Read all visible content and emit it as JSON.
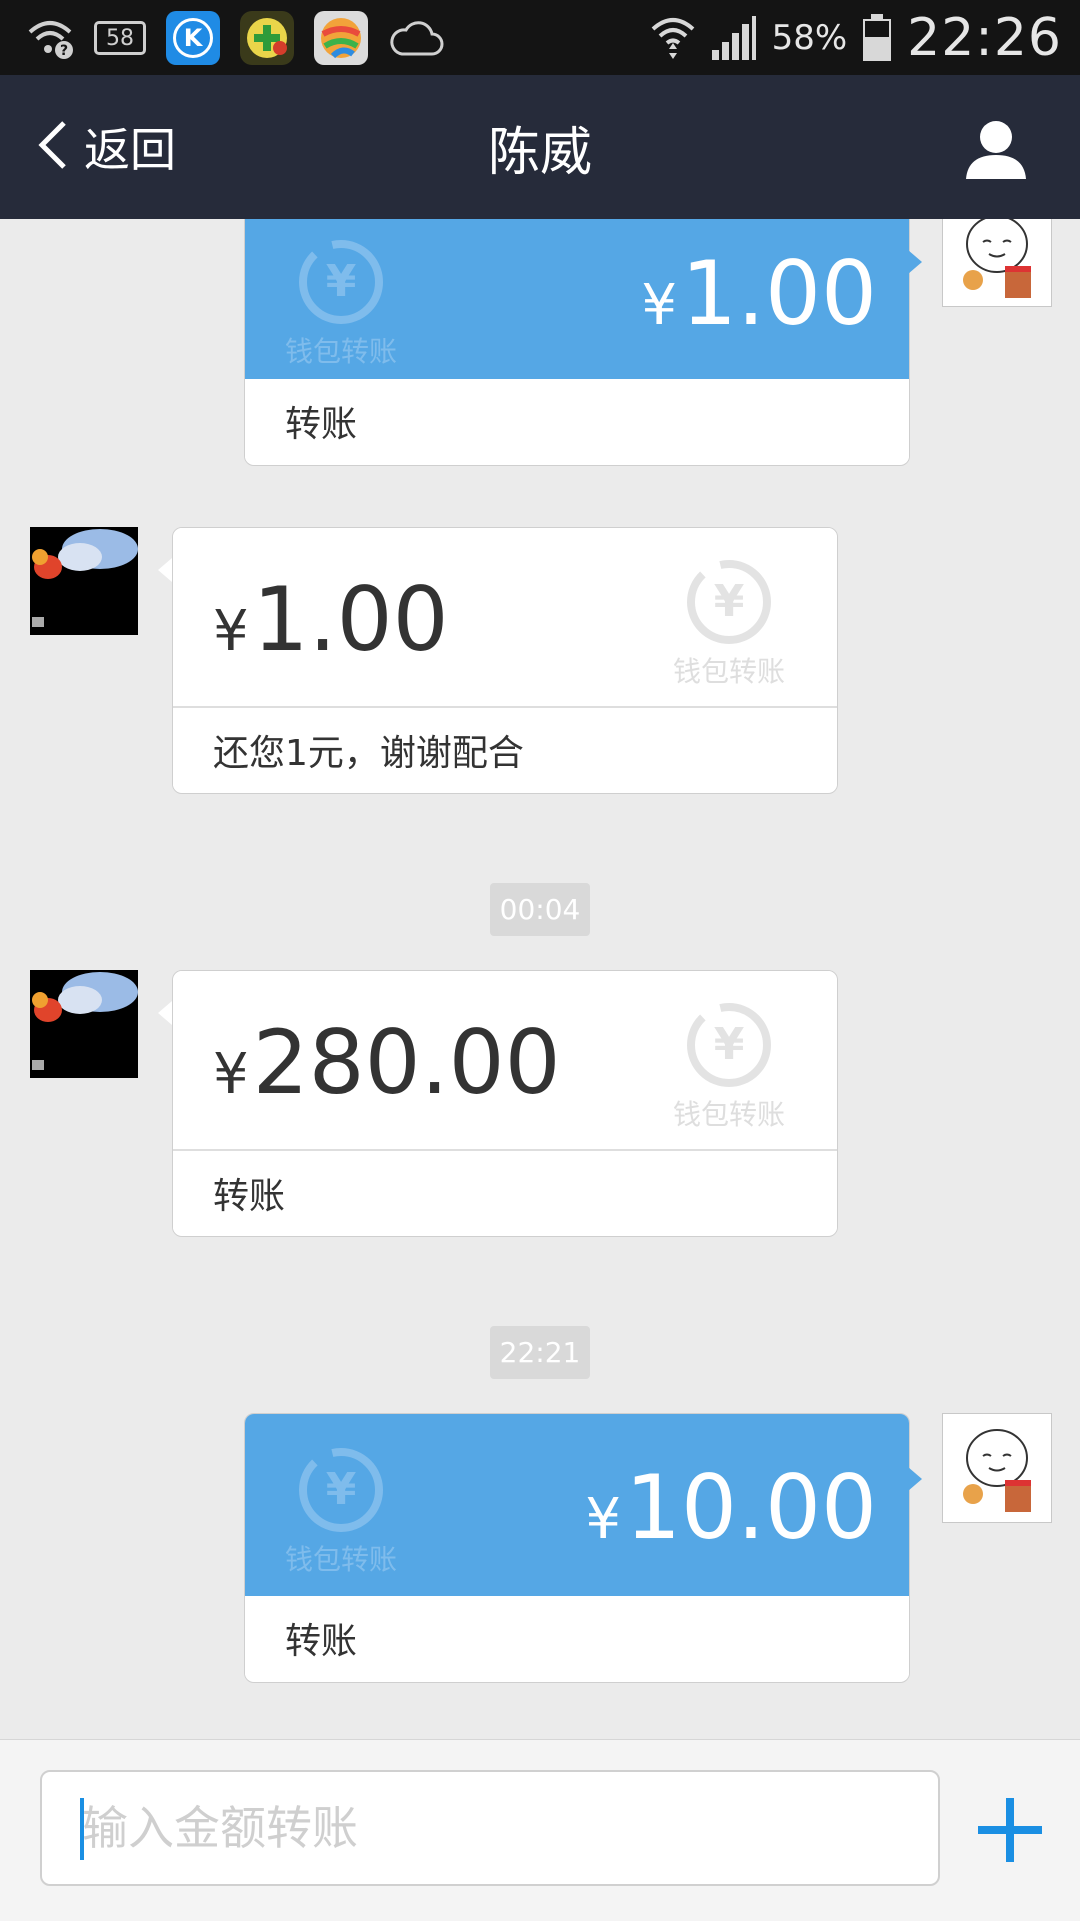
{
  "status_bar": {
    "notification_count": "58",
    "app_icon_k": "K",
    "battery_percent": "58%",
    "time": "22:26"
  },
  "header": {
    "back_label": "返回",
    "title": "陈威"
  },
  "messages": [
    {
      "direction": "out",
      "currency": "¥",
      "amount": "1.00",
      "note": "转账",
      "watermark": "钱包转账"
    },
    {
      "direction": "in",
      "currency": "¥",
      "amount": "1.00",
      "note": "还您1元，谢谢配合",
      "watermark": "钱包转账"
    },
    {
      "direction": "in",
      "currency": "¥",
      "amount": "280.00",
      "note": "转账",
      "watermark": "钱包转账"
    },
    {
      "direction": "out",
      "currency": "¥",
      "amount": "10.00",
      "note": "转账",
      "watermark": "钱包转账"
    }
  ],
  "timestamps": [
    "00:04",
    "22:21"
  ],
  "input": {
    "placeholder": "输入金额转账"
  },
  "colors": {
    "header_bg": "#262b3a",
    "outgoing_bubble": "#55a7e5",
    "accent": "#1a8fe3"
  },
  "icons": [
    "wifi-question-icon",
    "notification-icon",
    "app-k-icon",
    "app-game-icon",
    "app-ball-icon",
    "cloud-icon",
    "wifi-icon",
    "signal-icon",
    "battery-icon",
    "back-chevron-icon",
    "profile-icon",
    "yen-circle-icon",
    "plus-icon"
  ]
}
